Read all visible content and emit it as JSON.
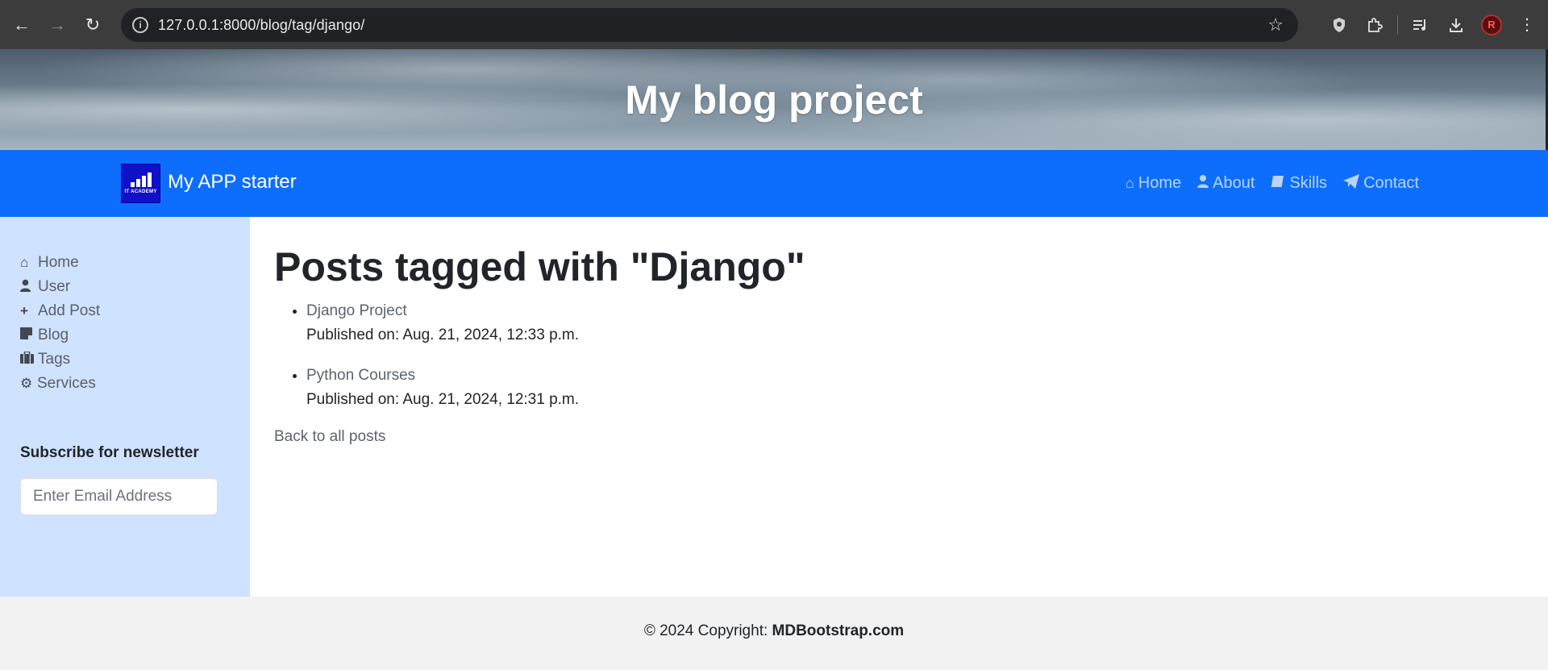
{
  "browser": {
    "url": "127.0.0.1:8000/blog/tag/django/",
    "back_icon": "arrow-left-icon",
    "forward_icon": "arrow-right-icon",
    "reload_icon": "reload-icon",
    "avatar_initial": "R"
  },
  "hero": {
    "title": "My blog project"
  },
  "navbar": {
    "brand_name": "My APP starter",
    "logo_text": "IT ACADEMY",
    "links": [
      {
        "label": "Home",
        "icon": "home-icon"
      },
      {
        "label": "About",
        "icon": "user-icon"
      },
      {
        "label": "Skills",
        "icon": "book-icon"
      },
      {
        "label": "Contact",
        "icon": "paper-plane-icon"
      }
    ],
    "link_color": "#b9d3fb",
    "background": "#0d6efd"
  },
  "sidebar": {
    "items": [
      {
        "label": "Home",
        "icon": "home-icon"
      },
      {
        "label": "User",
        "icon": "user-icon"
      },
      {
        "label": "Add Post",
        "icon": "plus-icon"
      },
      {
        "label": "Blog",
        "icon": "note-icon"
      },
      {
        "label": "Tags",
        "icon": "briefcase-icon"
      },
      {
        "label": "Services",
        "icon": "gears-icon"
      }
    ],
    "newsletter_title": "Subscribe for newsletter",
    "email_placeholder": "Enter Email Address",
    "background": "#cfe2ff"
  },
  "main": {
    "heading": "Posts tagged with \"Django\"",
    "posts": [
      {
        "title": "Django Project",
        "meta": "Published on: Aug. 21, 2024, 12:33 p.m."
      },
      {
        "title": "Python Courses",
        "meta": "Published on: Aug. 21, 2024, 12:31 p.m."
      }
    ],
    "back_link": "Back to all posts"
  },
  "footer": {
    "prefix": "© 2024 Copyright: ",
    "site": "MDBootstrap.com"
  }
}
